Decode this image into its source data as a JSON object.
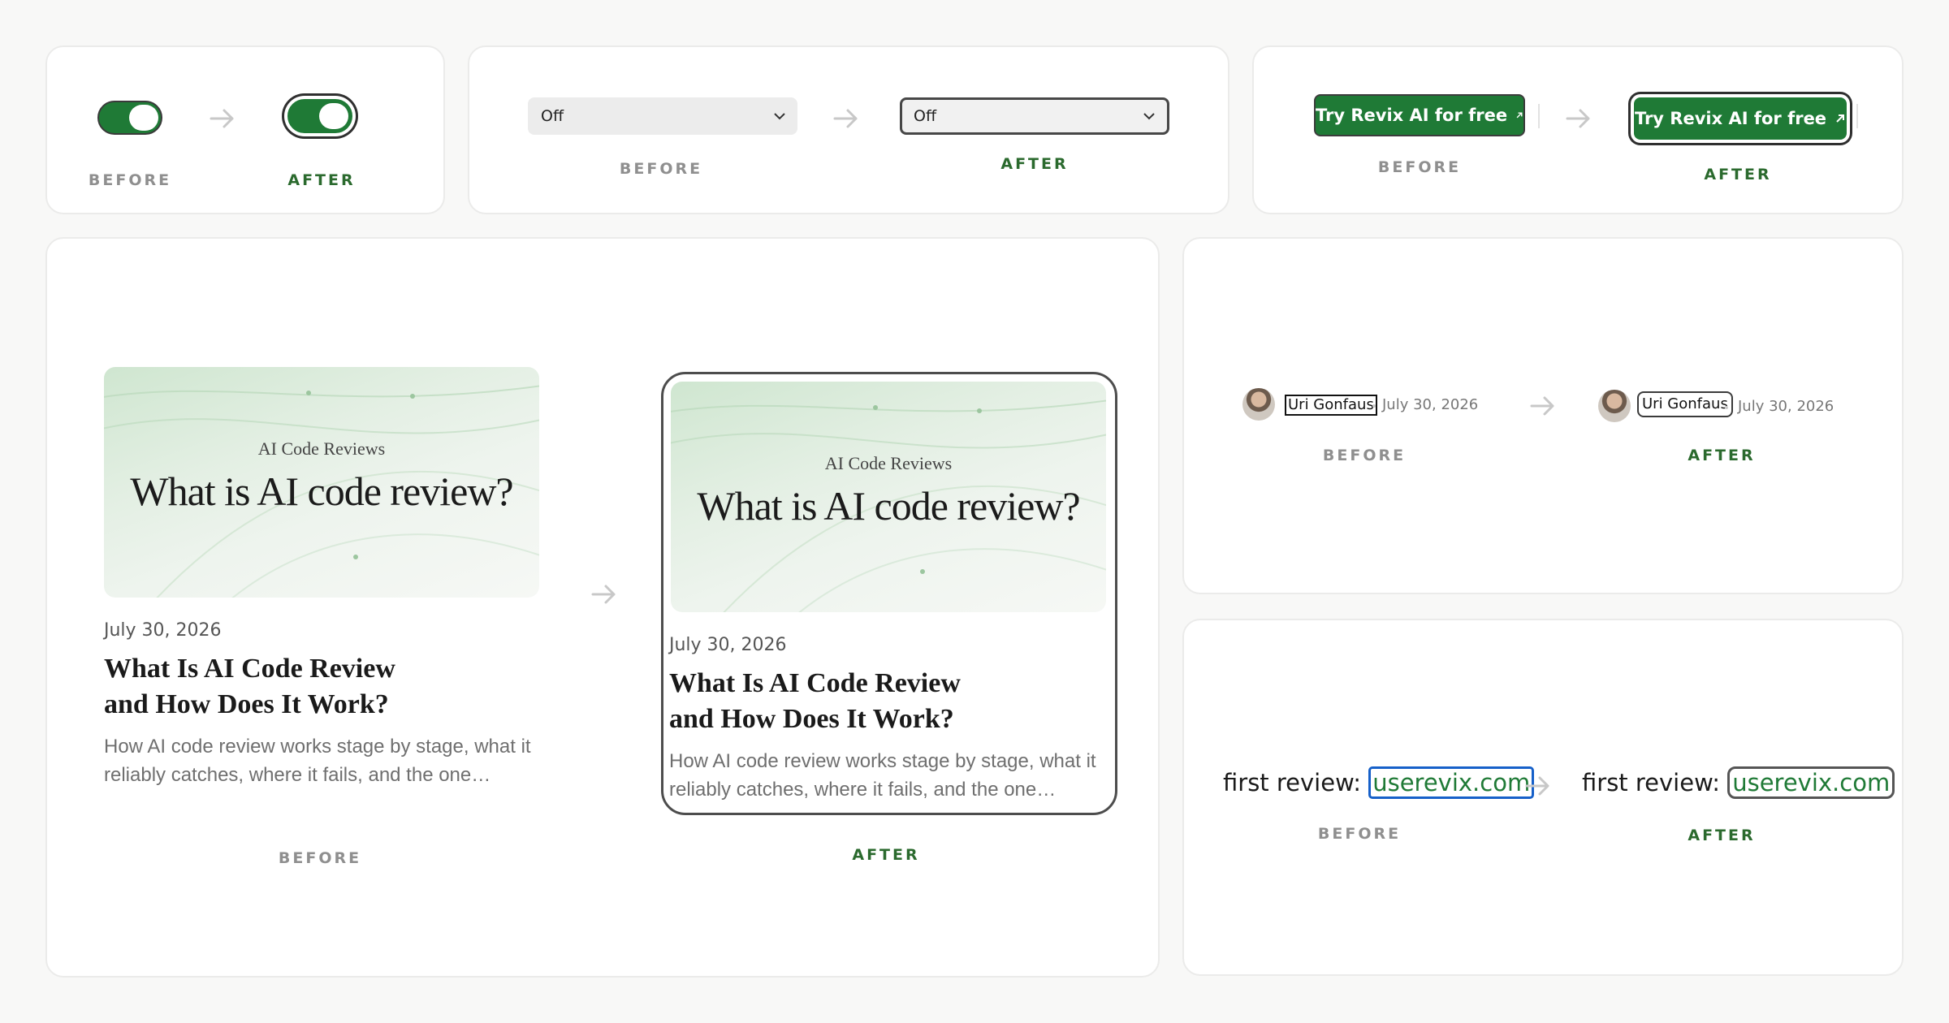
{
  "labels": {
    "before": "BEFORE",
    "after": "AFTER"
  },
  "toggle": {
    "state": "on",
    "accent": "#1f7a36"
  },
  "select": {
    "value": "Off"
  },
  "cta": {
    "label": "Try Revix AI for free",
    "icon": "arrow-up-right-icon",
    "accent": "#1f7a36"
  },
  "blog_card": {
    "cover_tag": "AI Code Reviews",
    "cover_headline": "What is AI code review?",
    "date": "July 30, 2026",
    "title_line1": "What Is AI Code Review",
    "title_line2": "and How Does It Work?",
    "excerpt": "How AI code review works stage by stage, what it reliably catches, where it fails, and the one…"
  },
  "author": {
    "name": "Uri Gonfaus",
    "date": "July 30, 2026",
    "avatar": "avatar-photo"
  },
  "link_demo": {
    "prefix": "first review:",
    "link_text": "userevix.com"
  },
  "colors": {
    "focus_ring": "#2f2f2f",
    "link_focus_blue": "#1660c9",
    "after_label": "#2b6a2e",
    "before_label": "#8f8f8f"
  }
}
